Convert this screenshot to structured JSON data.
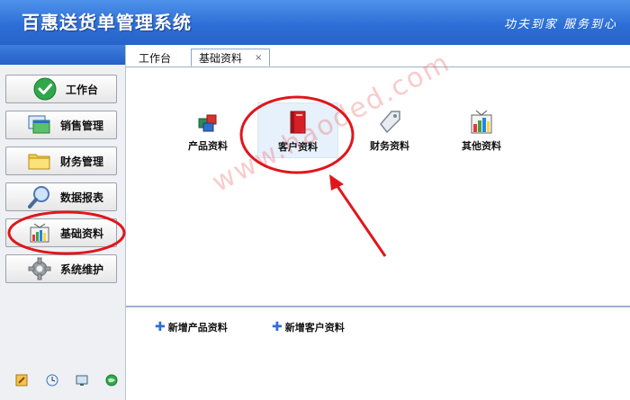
{
  "header": {
    "title": "百惠送货单管理系统",
    "slogan": "功夫到家 服务到心"
  },
  "sidebar": {
    "items": [
      {
        "label": "工作台",
        "icon": "check-icon"
      },
      {
        "label": "销售管理",
        "icon": "window-icon"
      },
      {
        "label": "财务管理",
        "icon": "folder-icon"
      },
      {
        "label": "数据报表",
        "icon": "magnifier-icon"
      },
      {
        "label": "基础资料",
        "icon": "chart-icon"
      },
      {
        "label": "系统维护",
        "icon": "gear-icon"
      }
    ],
    "bottom_icons": [
      "edit-icon",
      "clock-icon",
      "monitor-icon",
      "globe-icon"
    ]
  },
  "tabs": [
    {
      "label": "工作台"
    },
    {
      "label": "基础资料",
      "close": "×"
    }
  ],
  "tools": [
    {
      "label": "产品资料",
      "icon": "cubes-icon"
    },
    {
      "label": "客户资料",
      "icon": "red-book-icon"
    },
    {
      "label": "财务资料",
      "icon": "price-tag-icon"
    },
    {
      "label": "其他资料",
      "icon": "chart-icon"
    }
  ],
  "quick_actions": [
    {
      "label": "新增产品资料"
    },
    {
      "label": "新增客户资料"
    }
  ],
  "watermark": "www.haoded.com",
  "colors": {
    "header_blue": "#2d6fd6",
    "annotation_red": "#e0161c"
  }
}
